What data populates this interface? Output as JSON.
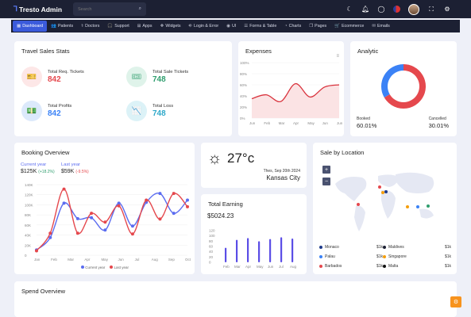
{
  "brand": {
    "name": "Tresto Admin"
  },
  "search": {
    "placeholder": "Search"
  },
  "nav": [
    {
      "label": "Dashboard",
      "icon": "▦"
    },
    {
      "label": "Patients",
      "icon": "👥"
    },
    {
      "label": "Doctors",
      "icon": "⚕"
    },
    {
      "label": "Support",
      "icon": "🎧"
    },
    {
      "label": "Apps",
      "icon": "⊞"
    },
    {
      "label": "Widgets",
      "icon": "❖"
    },
    {
      "label": "Login & Error",
      "icon": "⎆"
    },
    {
      "label": "UI",
      "icon": "◉"
    },
    {
      "label": "Forms & Table",
      "icon": "☰"
    },
    {
      "label": "Charts",
      "icon": "◔"
    },
    {
      "label": "Pages",
      "icon": "❐"
    },
    {
      "label": "Ecommerce",
      "icon": "🛒"
    },
    {
      "label": "Emails",
      "icon": "✉"
    }
  ],
  "travel": {
    "title": "Travel Sales Stats",
    "stats": [
      {
        "label": "Total Req. Tickets",
        "value": "842",
        "color": "#e5484d",
        "bg": "#fde7e7",
        "icon": "🎫"
      },
      {
        "label": "Total Sale Tickets",
        "value": "748",
        "color": "#2f9e6e",
        "bg": "#dff3ea",
        "icon": "🎟"
      },
      {
        "label": "Total Profits",
        "value": "842",
        "color": "#3b82f6",
        "bg": "#dce9fb",
        "icon": "💵"
      },
      {
        "label": "Total Loss",
        "value": "748",
        "color": "#2ea8c9",
        "bg": "#dcf2f7",
        "icon": "📉"
      }
    ]
  },
  "expenses": {
    "title": "Expenses",
    "yticks": [
      "100%",
      "80%",
      "60%",
      "40%",
      "20%",
      "0%"
    ],
    "months": [
      "Jun",
      "Feb",
      "Mar",
      "Apr",
      "May",
      "Jun",
      "Jun"
    ]
  },
  "analytic": {
    "title": "Analytic",
    "booked_label": "Booked",
    "booked_value": "60.01%",
    "cancelled_label": "Cancelled",
    "cancelled_value": "30.01%"
  },
  "booking": {
    "title": "Booking Overview",
    "current_label": "Current year",
    "current_value": "$125K",
    "current_change": "(+18.2%)",
    "last_label": "Last year",
    "last_value": "$59K",
    "last_change": "(-9.5%)",
    "legend_current": "Current year",
    "legend_last": "Last year"
  },
  "weather": {
    "temp": "27°c",
    "date": "Thes, Sep 20th 2024",
    "city": "Kansas City"
  },
  "earning": {
    "title": "Total Earning",
    "value": "$5024.23"
  },
  "location": {
    "title": "Sale by Location",
    "items": [
      {
        "name": "Monaco",
        "value": "$1k",
        "color": "#1e3a8a"
      },
      {
        "name": "Maldives",
        "value": "$1k",
        "color": "#1c2033"
      },
      {
        "name": "Palau",
        "value": "$1k",
        "color": "#3b82f6"
      },
      {
        "name": "Singapore",
        "value": "$1k",
        "color": "#f59e0b"
      },
      {
        "name": "Barbados",
        "value": "$1k",
        "color": "#e5484d"
      },
      {
        "name": "Malta",
        "value": "$1k",
        "color": "#111111"
      }
    ]
  },
  "spend": {
    "title": "Spend Overview"
  },
  "chart_data": [
    {
      "type": "area",
      "title": "Expenses",
      "x": [
        "Jun",
        "Feb",
        "Mar",
        "Apr",
        "May",
        "Jun",
        "Jun"
      ],
      "series": [
        {
          "values": [
            35,
            42,
            30,
            62,
            38,
            56,
            60
          ]
        }
      ],
      "ylim": [
        0,
        100
      ]
    },
    {
      "type": "pie",
      "title": "Analytic",
      "labels": [
        "Booked",
        "Cancelled"
      ],
      "values": [
        60.01,
        30.01
      ],
      "colors": [
        "#e5484d",
        "#3b82f6"
      ]
    },
    {
      "type": "line",
      "title": "Booking Overview",
      "x": [
        "Jan",
        "Feb",
        "Mar",
        "Apr",
        "May",
        "Jun",
        "Jul",
        "Aug",
        "Sep",
        "Oct"
      ],
      "series": [
        {
          "name": "Current year",
          "values": [
            12,
            40,
            118,
            83,
            85,
            57,
            118,
            66,
            120,
            140,
            95,
            125
          ],
          "color": "#5b6cf0"
        },
        {
          "name": "Last year",
          "values": [
            10,
            50,
            150,
            50,
            95,
            75,
            112,
            48,
            125,
            82,
            140,
            110
          ],
          "color": "#e5484d"
        }
      ],
      "yticks": [
        "0",
        "20K",
        "40K",
        "60K",
        "80K",
        "100K",
        "120K",
        "140K"
      ],
      "ylim": [
        0,
        160
      ]
    },
    {
      "type": "bar",
      "title": "Total Earning",
      "categories": [
        "Feb",
        "Mar",
        "Apr",
        "May",
        "Jun",
        "Jul",
        "Aug"
      ],
      "values": [
        55,
        85,
        92,
        80,
        88,
        95,
        90
      ],
      "yticks": [
        "0",
        "20",
        "40",
        "60",
        "80",
        "100",
        "120"
      ],
      "ylim": [
        0,
        120
      ]
    }
  ]
}
